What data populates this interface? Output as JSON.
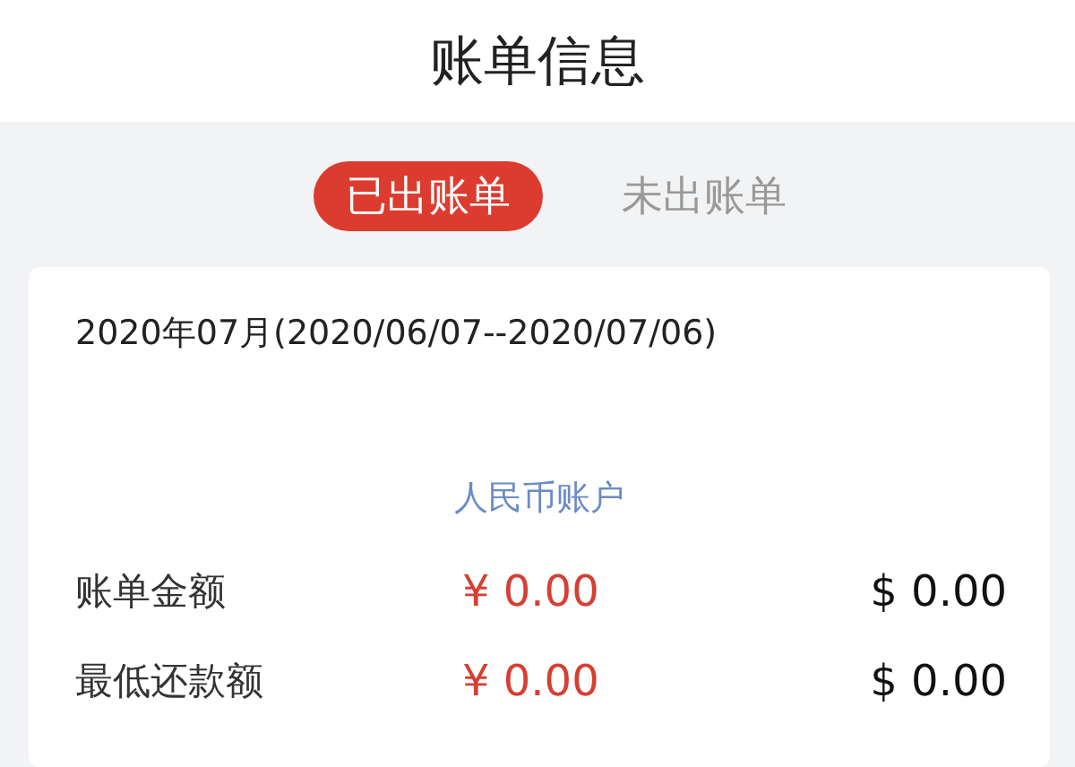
{
  "title": "账单信息",
  "tabs": [
    {
      "label": "已出账单",
      "selected": true
    },
    {
      "label": "未出账单",
      "selected": false
    }
  ],
  "period": "2020年07月(2020/06/07--2020/07/06)",
  "account": "人民币账户",
  "rows": [
    {
      "label": "账单金额",
      "rmb": "¥ 0.00",
      "usd": "$ 0.00"
    },
    {
      "label": "最低还款额",
      "rmb": "¥ 0.00",
      "usd": "$ 0.00"
    }
  ]
}
